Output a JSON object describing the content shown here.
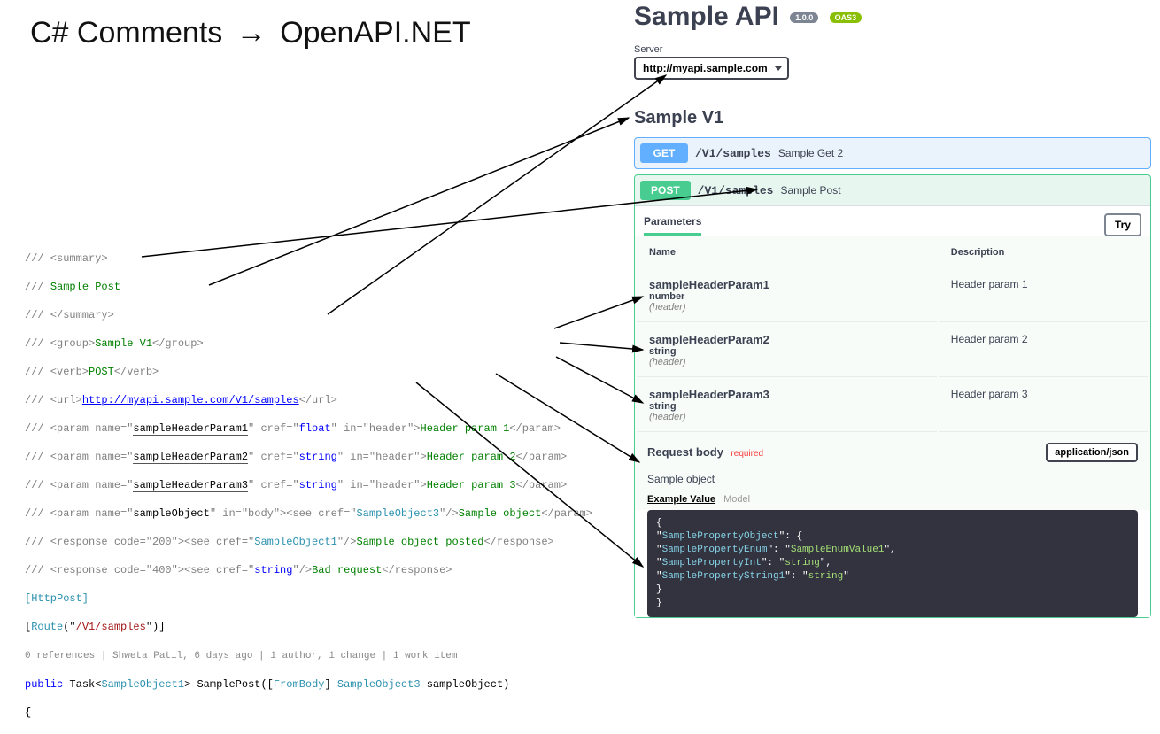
{
  "title_left": "C# Comments",
  "title_right": "OpenAPI.NET",
  "code": {
    "t01a": "/// <summary>",
    "t02a": "/// ",
    "t02_summary": "Sample Post",
    "t03a": "/// </summary>",
    "t04a": "/// <group>",
    "t04_group": "Sample V1",
    "t04b": "</group>",
    "t05a": "/// <verb>",
    "t05_verb": "POST",
    "t05b": "</verb>",
    "t06a": "/// <url>",
    "t06_url": "http://myapi.sample.com/V1/samples",
    "t06b": "</url>",
    "t07a": "/// <param name=\"",
    "t07_name": "sampleHeaderParam1",
    "t07b": "\" cref=\"",
    "t07_type": "float",
    "t07c": "\" in=\"header\">",
    "t07_desc": "Header param 1",
    "t07d": "</param>",
    "t08a": "/// <param name=\"",
    "t08_name": "sampleHeaderParam2",
    "t08b": "\" cref=\"",
    "t08_type": "string",
    "t08c": "\" in=\"header\">",
    "t08_desc": "Header param 2",
    "t08d": "</param>",
    "t09a": "/// <param name=\"",
    "t09_name": "sampleHeaderParam3",
    "t09b": "\" cref=\"",
    "t09_type": "string",
    "t09c": "\" in=\"header\">",
    "t09_desc": "Header param 3",
    "t09d": "</param>",
    "t10a": "/// <param name=\"",
    "t10_name": "sampleObject",
    "t10b": "\" in=\"body\"><see cref=\"",
    "t10_type": "SampleObject3",
    "t10c": "\"/>",
    "t10_desc": "Sample object",
    "t10d": "</param>",
    "t11a": "/// <response code=\"200\"><see cref=\"",
    "t11_type": "SampleObject1",
    "t11b": "\"/>",
    "t11_desc": "Sample object posted",
    "t11c": "</response>",
    "t12a": "/// <response code=\"400\"><see cref=\"",
    "t12_type": "string",
    "t12b": "\"/>",
    "t12_desc": "Bad request",
    "t12c": "</response>",
    "t13_attr1": "[HttpPost]",
    "t14a": "[",
    "t14_attr": "Route",
    "t14b": "(\"",
    "t14_route": "/V1/samples",
    "t14c": "\")]",
    "t15_codelens": "0 references | Shweta Patil, 6 days ago | 1 author, 1 change | 1 work item",
    "t16_kw_public": "public",
    "t16_task": " Task<",
    "t16_type1": "SampleObject1",
    "t16_mid": "> SamplePost([",
    "t16_frombody": "FromBody",
    "t16_mid2": "] ",
    "t16_type2": "SampleObject3",
    "t16_end": " sampleObject)",
    "t17_brace": "{"
  },
  "swagger": {
    "api_title": "Sample API",
    "badge_version": "1.0.0",
    "badge_oas": "OAS3",
    "server_label": "Server",
    "server_value": "http://myapi.sample.com",
    "section": "Sample V1",
    "get": {
      "method": "GET",
      "path": "/V1/samples",
      "desc": "Sample Get 2"
    },
    "post": {
      "method": "POST",
      "path": "/V1/samples",
      "desc": "Sample Post"
    },
    "params_tab": "Parameters",
    "try_label": "Try",
    "col_name": "Name",
    "col_desc": "Description",
    "params": [
      {
        "name": "sampleHeaderParam1",
        "type": "number",
        "in": "(header)",
        "desc": "Header param 1"
      },
      {
        "name": "sampleHeaderParam2",
        "type": "string",
        "in": "(header)",
        "desc": "Header param 2"
      },
      {
        "name": "sampleHeaderParam3",
        "type": "string",
        "in": "(header)",
        "desc": "Header param 3"
      }
    ],
    "rb_title": "Request body",
    "rb_required": "required",
    "rb_ct": "application/json",
    "rb_desc": "Sample object",
    "rb_tab_example": "Example Value",
    "rb_tab_model": "Model",
    "example_lines": {
      "l1": "{",
      "l2a": "  \"",
      "l2_key": "SamplePropertyObject",
      "l2b": "\": {",
      "l3a": "    \"",
      "l3_key": "SamplePropertyEnum",
      "l3b": "\": \"",
      "l3_val": "SampleEnumValue1",
      "l3c": "\",",
      "l4a": "    \"",
      "l4_key": "SamplePropertyInt",
      "l4b": "\": \"",
      "l4_val": "string",
      "l4c": "\",",
      "l5a": "    \"",
      "l5_key": "SamplePropertyString1",
      "l5b": "\": \"",
      "l5_val": "string",
      "l5c": "\"",
      "l6": "  }",
      "l7": "}"
    }
  }
}
